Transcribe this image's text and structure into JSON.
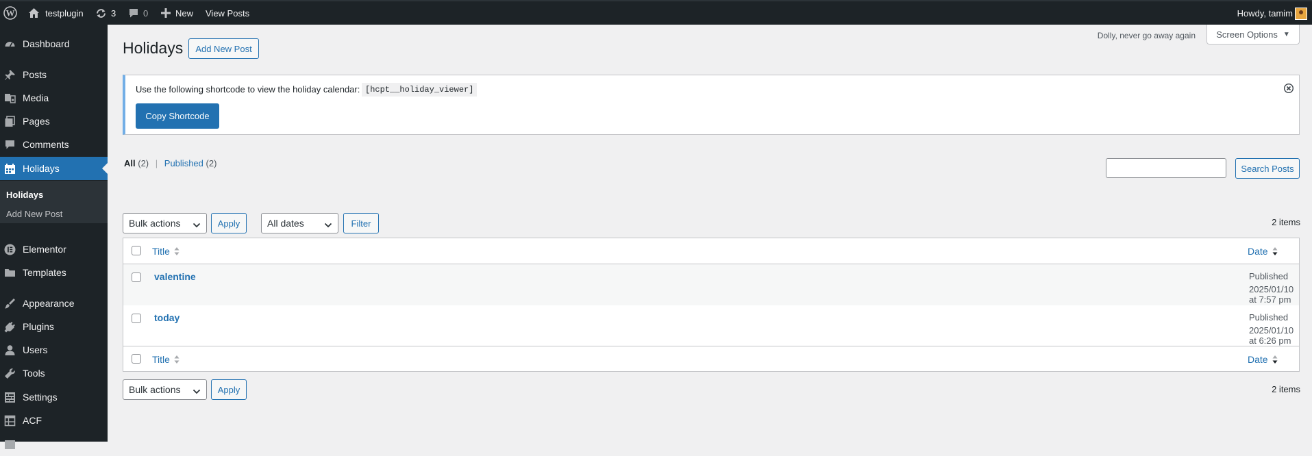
{
  "adminbar": {
    "site_name": "testplugin",
    "updates_count": "3",
    "comments_count": "0",
    "new_label": "New",
    "view_posts_label": "View Posts",
    "howdy": "Howdy, tamim"
  },
  "sidebar": {
    "items": [
      {
        "label": "Dashboard",
        "icon": "dashboard-icon"
      },
      {
        "label": "Posts",
        "icon": "pin-icon"
      },
      {
        "label": "Media",
        "icon": "media-icon"
      },
      {
        "label": "Pages",
        "icon": "pages-icon"
      },
      {
        "label": "Comments",
        "icon": "comment-icon"
      },
      {
        "label": "Holidays",
        "icon": "calendar-icon",
        "active": true
      },
      {
        "label": "Elementor",
        "icon": "elementor-icon"
      },
      {
        "label": "Templates",
        "icon": "folder-icon"
      },
      {
        "label": "Appearance",
        "icon": "brush-icon"
      },
      {
        "label": "Plugins",
        "icon": "plug-icon"
      },
      {
        "label": "Users",
        "icon": "user-icon"
      },
      {
        "label": "Tools",
        "icon": "wrench-icon"
      },
      {
        "label": "Settings",
        "icon": "settings-icon"
      },
      {
        "label": "ACF",
        "icon": "table-icon"
      }
    ],
    "submenu": [
      "Holidays",
      "Add New Post"
    ]
  },
  "header": {
    "dolly": "Dolly, never go away again",
    "screen_options": "Screen Options",
    "title": "Holidays",
    "add_new": "Add New Post"
  },
  "notice": {
    "text": "Use the following shortcode to view the holiday calendar:",
    "code": "[hcpt__holiday_viewer]",
    "copy_button": "Copy Shortcode"
  },
  "views": {
    "all_label": "All",
    "all_count": "(2)",
    "published_label": "Published",
    "published_count": "(2)"
  },
  "search": {
    "button": "Search Posts",
    "value": ""
  },
  "tablenav": {
    "bulk_actions": "Bulk actions",
    "apply": "Apply",
    "all_dates": "All dates",
    "filter": "Filter",
    "items_count": "2 items"
  },
  "table": {
    "columns": {
      "title": "Title",
      "date": "Date"
    },
    "rows": [
      {
        "title": "valentine",
        "status": "Published",
        "date": "2025/01/10 at 7:57 pm"
      },
      {
        "title": "today",
        "status": "Published",
        "date": "2025/01/10 at 6:26 pm"
      }
    ]
  },
  "colors": {
    "accent": "#2271b1",
    "adminbar": "#1d2327",
    "background": "#f0f0f1",
    "notice_border": "#72aee6"
  }
}
